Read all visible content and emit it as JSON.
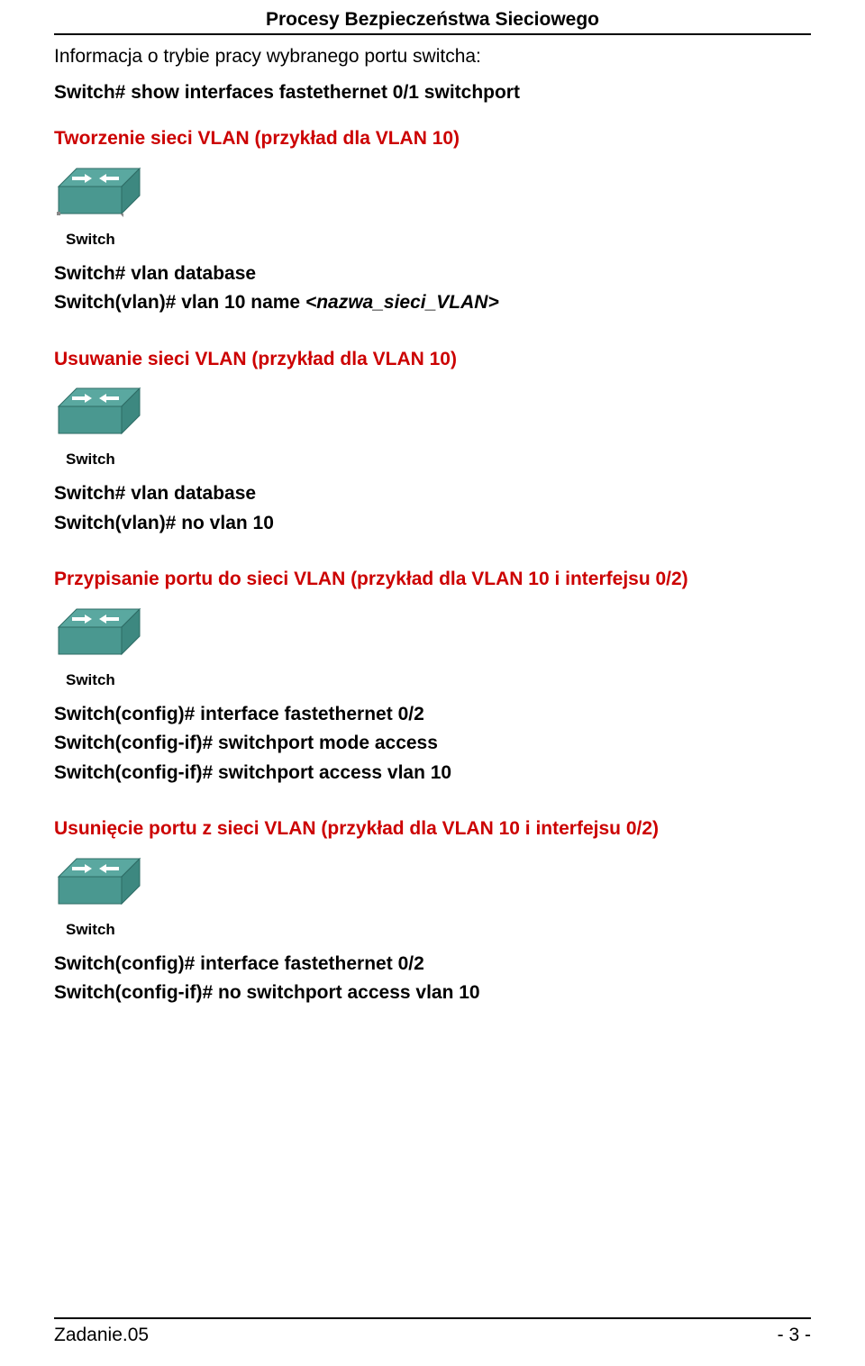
{
  "header": {
    "title": "Procesy Bezpieczeństwa Sieciowego"
  },
  "intro": {
    "line1": "Informacja o trybie pracy wybranego portu switcha:",
    "cmd1": "Switch# show interfaces fastethernet 0/1 switchport"
  },
  "section1": {
    "title": "Tworzenie sieci VLAN (przykład dla VLAN 10)",
    "cmd1": "Switch# vlan database",
    "cmd2_prefix": "Switch(vlan)# vlan 10 name ",
    "cmd2_param": "<nazwa_sieci_VLAN>"
  },
  "section2": {
    "title": "Usuwanie sieci VLAN (przykład dla VLAN 10)",
    "cmd1": "Switch# vlan database",
    "cmd2": "Switch(vlan)# no vlan 10"
  },
  "section3": {
    "title": "Przypisanie portu do sieci VLAN (przykład dla VLAN 10 i interfejsu 0/2)",
    "cmd1": "Switch(config)# interface fastethernet 0/2",
    "cmd2": "Switch(config-if)# switchport mode access",
    "cmd3": "Switch(config-if)# switchport access vlan 10"
  },
  "section4": {
    "title": "Usunięcie portu z sieci VLAN (przykład dla VLAN 10 i interfejsu 0/2)",
    "cmd1": "Switch(config)# interface fastethernet 0/2",
    "cmd2": "Switch(config-if)# no switchport access vlan 10"
  },
  "switch_label": "Switch",
  "footer": {
    "left": "Zadanie.05",
    "right": "- 3 -"
  }
}
